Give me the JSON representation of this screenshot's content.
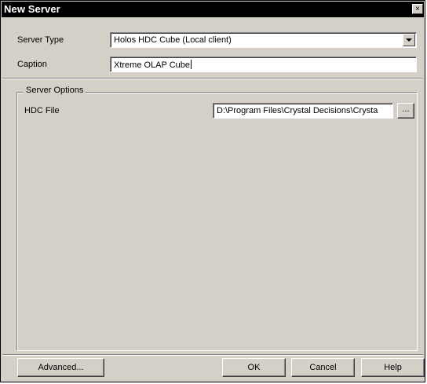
{
  "window": {
    "title": "New Server",
    "close_glyph": "×"
  },
  "form": {
    "server_type_label": "Server Type",
    "server_type_value": "Holos HDC Cube (Local client)",
    "caption_label": "Caption",
    "caption_value": "Xtreme OLAP Cube"
  },
  "server_options": {
    "legend": "Server Options",
    "hdc_file_label": "HDC File",
    "hdc_file_value": "D:\\Program Files\\Crystal Decisions\\Crysta",
    "browse_label": "..."
  },
  "buttons": {
    "advanced": "Advanced...",
    "ok": "OK",
    "cancel": "Cancel",
    "help": "Help"
  }
}
